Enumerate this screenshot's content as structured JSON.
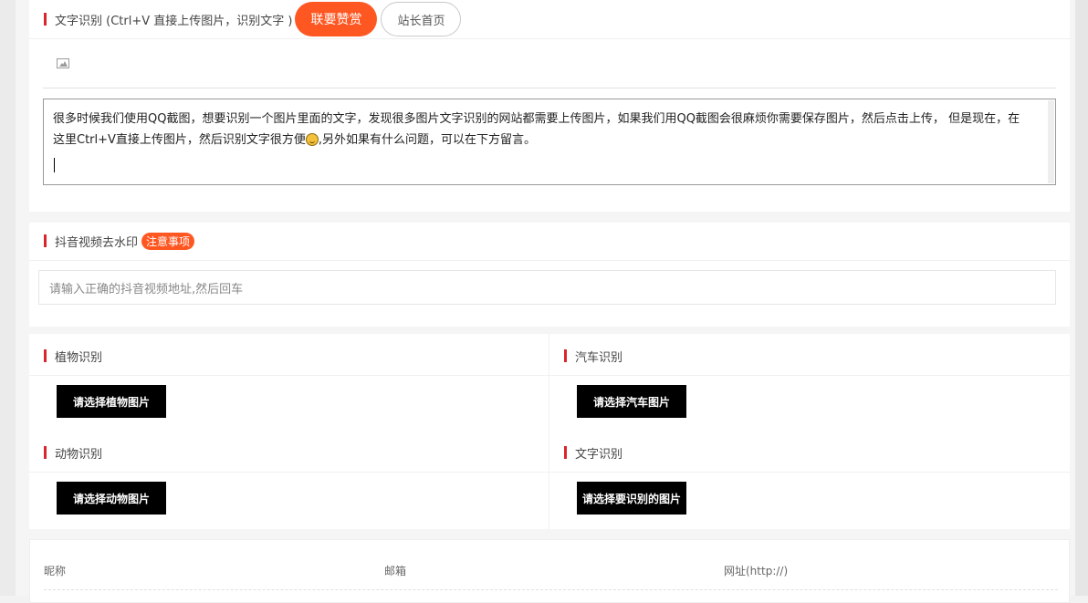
{
  "ocr_section": {
    "title": "文字识别 (Ctrl+V 直接上传图片，识别文字 )",
    "donate_label": "联要赞赏",
    "home_label": "站长首页",
    "text": "很多时候我们使用QQ截图，想要识别一个图片里面的文字，发现很多图片文字识别的网站都需要上传图片，如果我们用QQ截图会很麻烦你需要保存图片，然后点击上传， 但是现在，在这里Ctrl+V直接上传图片，然后识别文字很方便",
    "text_after_emoji": ",另外如果有什么问题，可以在下方留言。"
  },
  "douyin_section": {
    "title": "抖音视频去水印",
    "badge": "注意事项",
    "placeholder": "请输入正确的抖音视频地址,然后回车"
  },
  "recognition": {
    "plant": {
      "title": "植物识别",
      "button": "请选择植物图片"
    },
    "car": {
      "title": "汽车识别",
      "button": "请选择汽车图片"
    },
    "animal": {
      "title": "动物识别",
      "button": "请选择动物图片"
    },
    "text": {
      "title": "文字识别",
      "button": "请选择要识别的图片"
    }
  },
  "comment_form": {
    "nickname_label": "昵称",
    "email_label": "邮箱",
    "url_label": "网址(http://)"
  },
  "colors": {
    "accent": "#ff5722",
    "marker": "#d9262c",
    "button_dark": "#000000"
  },
  "icons": {
    "image_upload": "image-icon",
    "emoji": "grin-emoji-icon"
  }
}
